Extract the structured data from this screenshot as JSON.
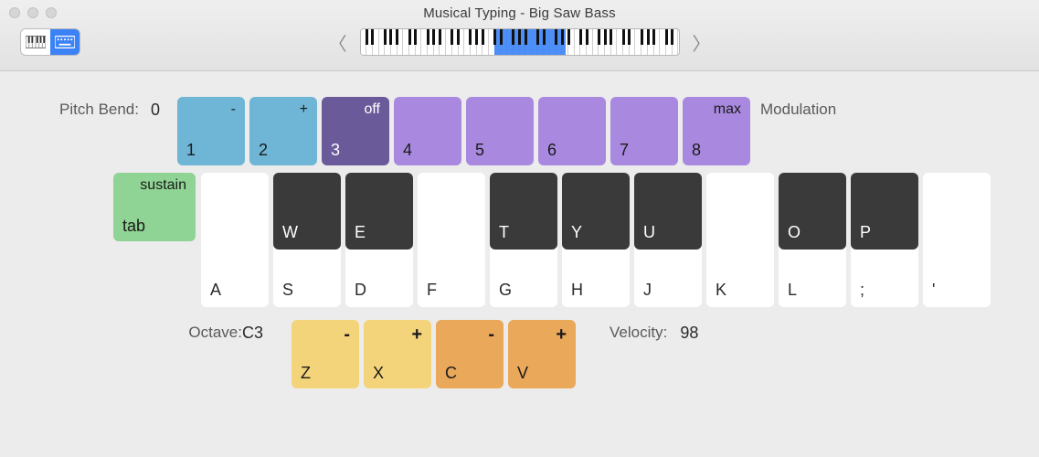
{
  "window": {
    "title": "Musical Typing - Big Saw Bass"
  },
  "pitch": {
    "label": "Pitch Bend:",
    "center": "0",
    "keys": [
      {
        "top": "-",
        "num": "1",
        "color": "c-lblue"
      },
      {
        "top": "+",
        "num": "2",
        "color": "c-lblue"
      },
      {
        "top": "off",
        "num": "3",
        "color": "c-dpurple"
      },
      {
        "top": "",
        "num": "4",
        "color": "c-purple"
      },
      {
        "top": "",
        "num": "5",
        "color": "c-purple"
      },
      {
        "top": "",
        "num": "6",
        "color": "c-purple"
      },
      {
        "top": "",
        "num": "7",
        "color": "c-purple"
      },
      {
        "top": "max",
        "num": "8",
        "color": "c-purple"
      }
    ],
    "modulation_label": "Modulation"
  },
  "sustain": {
    "top": "sustain",
    "bot": "tab"
  },
  "white_keys": [
    "A",
    "S",
    "D",
    "F",
    "G",
    "H",
    "J",
    "K",
    "L",
    ";",
    "'"
  ],
  "black_keys": [
    {
      "label": "W",
      "slot": 1
    },
    {
      "label": "E",
      "slot": 2
    },
    {
      "label": "T",
      "slot": 4
    },
    {
      "label": "Y",
      "slot": 5
    },
    {
      "label": "U",
      "slot": 6
    },
    {
      "label": "O",
      "slot": 8
    },
    {
      "label": "P",
      "slot": 9
    }
  ],
  "octave": {
    "label": "Octave:",
    "value": "C3",
    "keys": [
      {
        "top": "-",
        "bot": "Z",
        "color": "c-yellow"
      },
      {
        "top": "+",
        "bot": "X",
        "color": "c-yellow"
      },
      {
        "top": "-",
        "bot": "C",
        "color": "c-orange"
      },
      {
        "top": "+",
        "bot": "V",
        "color": "c-orange"
      }
    ]
  },
  "velocity": {
    "label": "Velocity:",
    "value": "98"
  },
  "mini": {
    "total_white": 52,
    "sel_start_pct": 42,
    "sel_width_pct": 22.5
  }
}
